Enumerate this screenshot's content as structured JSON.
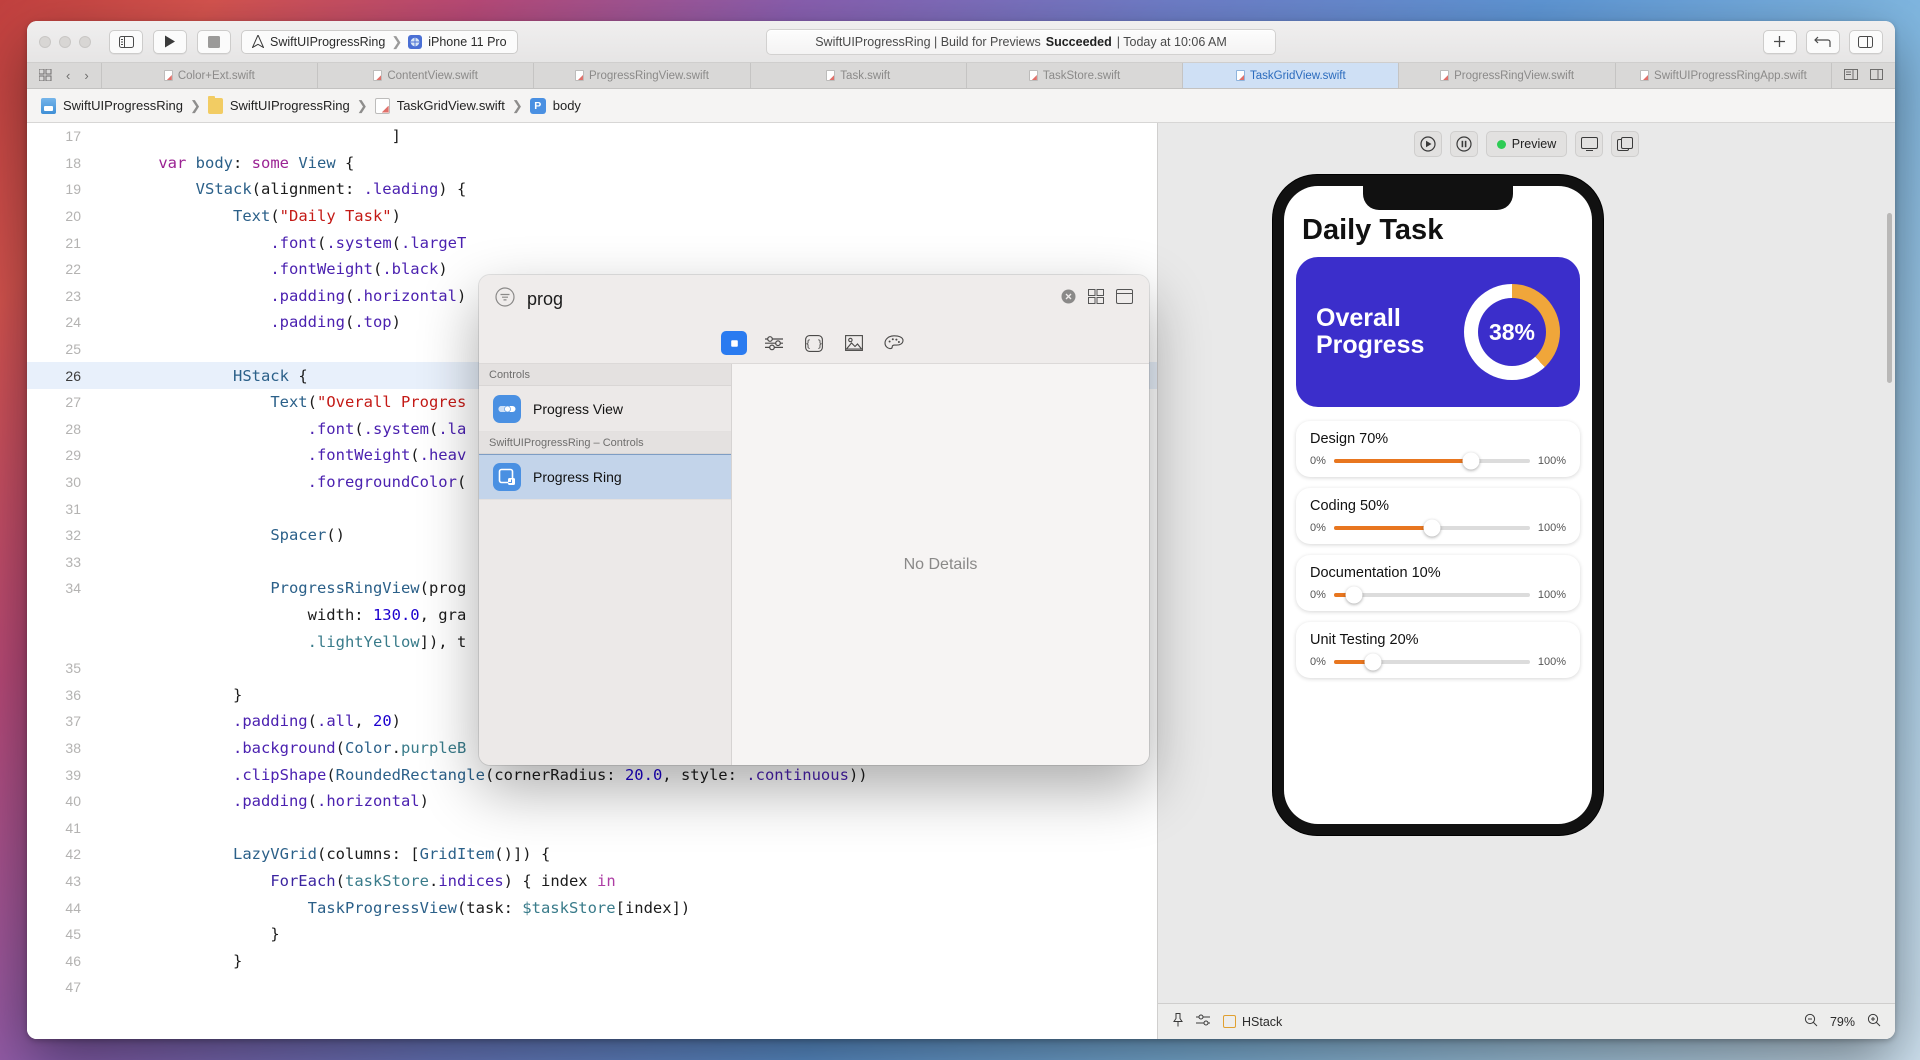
{
  "titlebar": {
    "scheme_project": "SwiftUIProgressRing",
    "scheme_device": "iPhone 11 Pro",
    "status": {
      "prefix": "SwiftUIProgressRing | Build for Previews ",
      "bold": "Succeeded",
      "suffix": " | Today at 10:06 AM"
    },
    "icons": {
      "sidebar": "sidebar-icon",
      "run": "run-play-icon",
      "stop": "stop-icon",
      "add": "plus-icon",
      "navigate": "code-review-icon",
      "inspector": "inspector-icon"
    }
  },
  "tabbar": {
    "tabs": [
      {
        "label": "Color+Ext.swift",
        "active": false
      },
      {
        "label": "ContentView.swift",
        "active": false
      },
      {
        "label": "ProgressRingView.swift",
        "active": false
      },
      {
        "label": "Task.swift",
        "active": false
      },
      {
        "label": "TaskStore.swift",
        "active": false
      },
      {
        "label": "TaskGridView.swift",
        "active": true
      },
      {
        "label": "ProgressRingView.swift",
        "active": false
      },
      {
        "label": "SwiftUIProgressRingApp.swift",
        "active": false
      }
    ]
  },
  "breadcrumb": {
    "items": [
      "SwiftUIProgressRing",
      "SwiftUIProgressRing",
      "TaskGridView.swift",
      "body"
    ],
    "symbol_badge": "P"
  },
  "editor": {
    "lines": [
      {
        "n": "17",
        "fold": false,
        "hl": false,
        "segs": [
          [
            "id",
            "                             ]"
          ]
        ]
      },
      {
        "n": "18",
        "fold": true,
        "hl": false,
        "segs": [
          [
            "id",
            "    "
          ],
          [
            "kw",
            "var"
          ],
          [
            "id",
            " "
          ],
          [
            "typ",
            "body"
          ],
          [
            "id",
            ": "
          ],
          [
            "kw",
            "some"
          ],
          [
            "id",
            " "
          ],
          [
            "typ",
            "View"
          ],
          [
            "id",
            " {"
          ]
        ]
      },
      {
        "n": "19",
        "fold": true,
        "hl": false,
        "segs": [
          [
            "id",
            "        "
          ],
          [
            "typ",
            "VStack"
          ],
          [
            "id",
            "(alignment: "
          ],
          [
            "mem",
            ".leading"
          ],
          [
            "id",
            ") {"
          ]
        ]
      },
      {
        "n": "20",
        "fold": false,
        "hl": false,
        "segs": [
          [
            "id",
            "            "
          ],
          [
            "typ",
            "Text"
          ],
          [
            "id",
            "("
          ],
          [
            "str",
            "\"Daily Task\""
          ],
          [
            "id",
            ")"
          ]
        ]
      },
      {
        "n": "21",
        "fold": false,
        "hl": false,
        "segs": [
          [
            "id",
            "                "
          ],
          [
            "mem",
            ".font"
          ],
          [
            "id",
            "("
          ],
          [
            "mem",
            ".system"
          ],
          [
            "id",
            "("
          ],
          [
            "mem",
            ".largeT"
          ]
        ]
      },
      {
        "n": "22",
        "fold": false,
        "hl": false,
        "segs": [
          [
            "id",
            "                "
          ],
          [
            "mem",
            ".fontWeight"
          ],
          [
            "id",
            "("
          ],
          [
            "mem",
            ".black"
          ],
          [
            "id",
            ")"
          ]
        ]
      },
      {
        "n": "23",
        "fold": false,
        "hl": false,
        "segs": [
          [
            "id",
            "                "
          ],
          [
            "mem",
            ".padding"
          ],
          [
            "id",
            "("
          ],
          [
            "mem",
            ".horizontal"
          ],
          [
            "id",
            ")"
          ]
        ]
      },
      {
        "n": "24",
        "fold": false,
        "hl": false,
        "segs": [
          [
            "id",
            "                "
          ],
          [
            "mem",
            ".padding"
          ],
          [
            "id",
            "("
          ],
          [
            "mem",
            ".top"
          ],
          [
            "id",
            ")"
          ]
        ]
      },
      {
        "n": "25",
        "fold": false,
        "hl": false,
        "segs": [
          [
            "id",
            ""
          ]
        ]
      },
      {
        "n": "26",
        "fold": true,
        "hl": true,
        "segs": [
          [
            "id",
            "            "
          ],
          [
            "typ",
            "HStack"
          ],
          [
            "id",
            " {"
          ]
        ]
      },
      {
        "n": "27",
        "fold": false,
        "hl": false,
        "segs": [
          [
            "id",
            "                "
          ],
          [
            "typ",
            "Text"
          ],
          [
            "id",
            "("
          ],
          [
            "str",
            "\"Overall Progres"
          ]
        ]
      },
      {
        "n": "28",
        "fold": false,
        "hl": false,
        "segs": [
          [
            "id",
            "                    "
          ],
          [
            "mem",
            ".font"
          ],
          [
            "id",
            "("
          ],
          [
            "mem",
            ".system"
          ],
          [
            "id",
            "("
          ],
          [
            "mem",
            ".la"
          ]
        ]
      },
      {
        "n": "29",
        "fold": false,
        "hl": false,
        "segs": [
          [
            "id",
            "                    "
          ],
          [
            "mem",
            ".fontWeight"
          ],
          [
            "id",
            "("
          ],
          [
            "mem",
            ".heav"
          ]
        ]
      },
      {
        "n": "30",
        "fold": false,
        "hl": false,
        "segs": [
          [
            "id",
            "                    "
          ],
          [
            "mem",
            ".foregroundColor"
          ],
          [
            "id",
            "("
          ]
        ]
      },
      {
        "n": "31",
        "fold": false,
        "hl": false,
        "segs": [
          [
            "id",
            ""
          ]
        ]
      },
      {
        "n": "32",
        "fold": false,
        "hl": false,
        "segs": [
          [
            "id",
            "                "
          ],
          [
            "typ",
            "Spacer"
          ],
          [
            "id",
            "()"
          ]
        ]
      },
      {
        "n": "33",
        "fold": false,
        "hl": false,
        "segs": [
          [
            "id",
            ""
          ]
        ]
      },
      {
        "n": "34",
        "fold": true,
        "hl": false,
        "segs": [
          [
            "id",
            "                "
          ],
          [
            "typ",
            "ProgressRingView"
          ],
          [
            "id",
            "(prog"
          ]
        ]
      },
      {
        "n": "",
        "fold": true,
        "hl": false,
        "segs": [
          [
            "id",
            "                    width: "
          ],
          [
            "num",
            "130.0"
          ],
          [
            "id",
            ", gra"
          ]
        ]
      },
      {
        "n": "",
        "fold": true,
        "hl": false,
        "segs": [
          [
            "id",
            "                    "
          ],
          [
            "tealid",
            ".lightYellow"
          ],
          [
            "id",
            "]), t"
          ]
        ]
      },
      {
        "n": "35",
        "fold": false,
        "hl": false,
        "segs": [
          [
            "id",
            ""
          ]
        ]
      },
      {
        "n": "36",
        "fold": true,
        "hl": false,
        "segs": [
          [
            "id",
            "            }"
          ]
        ]
      },
      {
        "n": "37",
        "fold": false,
        "hl": false,
        "segs": [
          [
            "id",
            "            "
          ],
          [
            "mem",
            ".padding"
          ],
          [
            "id",
            "("
          ],
          [
            "mem",
            ".all"
          ],
          [
            "id",
            ", "
          ],
          [
            "num",
            "20"
          ],
          [
            "id",
            ")"
          ]
        ]
      },
      {
        "n": "38",
        "fold": false,
        "hl": false,
        "segs": [
          [
            "id",
            "            "
          ],
          [
            "mem",
            ".background"
          ],
          [
            "id",
            "("
          ],
          [
            "typ",
            "Color"
          ],
          [
            "id",
            "."
          ],
          [
            "tealid",
            "purpleB"
          ]
        ]
      },
      {
        "n": "39",
        "fold": false,
        "hl": false,
        "segs": [
          [
            "id",
            "            "
          ],
          [
            "mem",
            ".clipShape"
          ],
          [
            "id",
            "("
          ],
          [
            "typ",
            "RoundedRectangle"
          ],
          [
            "id",
            "(cornerRadius: "
          ],
          [
            "num",
            "20.0"
          ],
          [
            "id",
            ", style: "
          ],
          [
            "mem",
            ".continuous"
          ],
          [
            "id",
            "))"
          ]
        ]
      },
      {
        "n": "40",
        "fold": false,
        "hl": false,
        "segs": [
          [
            "id",
            "            "
          ],
          [
            "mem",
            ".padding"
          ],
          [
            "id",
            "("
          ],
          [
            "mem",
            ".horizontal"
          ],
          [
            "id",
            ")"
          ]
        ]
      },
      {
        "n": "41",
        "fold": false,
        "hl": false,
        "segs": [
          [
            "id",
            ""
          ]
        ]
      },
      {
        "n": "42",
        "fold": true,
        "hl": false,
        "segs": [
          [
            "id",
            "            "
          ],
          [
            "typ",
            "LazyVGrid"
          ],
          [
            "id",
            "(columns: ["
          ],
          [
            "typ",
            "GridItem"
          ],
          [
            "id",
            "()]) {"
          ]
        ]
      },
      {
        "n": "43",
        "fold": true,
        "hl": false,
        "segs": [
          [
            "id",
            "                "
          ],
          [
            "fn",
            "ForEach"
          ],
          [
            "id",
            "("
          ],
          [
            "tealid",
            "taskStore"
          ],
          [
            "id",
            "."
          ],
          [
            "mem",
            "indices"
          ],
          [
            "id",
            ") { index "
          ],
          [
            "pinkkw",
            "in"
          ]
        ]
      },
      {
        "n": "44",
        "fold": true,
        "hl": false,
        "segs": [
          [
            "id",
            "                    "
          ],
          [
            "typ",
            "TaskProgressView"
          ],
          [
            "id",
            "(task: "
          ],
          [
            "tealid",
            "$taskStore"
          ],
          [
            "id",
            "[index])"
          ]
        ]
      },
      {
        "n": "45",
        "fold": true,
        "hl": false,
        "segs": [
          [
            "id",
            "                "
          ],
          [
            "id",
            "}"
          ]
        ]
      },
      {
        "n": "46",
        "fold": true,
        "hl": false,
        "segs": [
          [
            "id",
            "            }"
          ]
        ]
      },
      {
        "n": "47",
        "fold": false,
        "hl": false,
        "segs": [
          [
            "id",
            ""
          ]
        ]
      }
    ]
  },
  "library": {
    "search_value": "prog",
    "search_icon": "filter-icon",
    "clear_icon": "clear-circle-icon",
    "grid_icon": "grid-layout-icon",
    "detail_icon": "detail-panel-icon",
    "segments": [
      {
        "name": "views-segment",
        "icon": "square-views-icon",
        "active": true
      },
      {
        "name": "modifiers-segment",
        "icon": "sliders-icon",
        "active": false
      },
      {
        "name": "snippets-segment",
        "icon": "braces-icon",
        "active": false
      },
      {
        "name": "media-segment",
        "icon": "image-icon",
        "active": false
      },
      {
        "name": "color-segment",
        "icon": "palette-icon",
        "active": false
      }
    ],
    "groups": [
      {
        "header": "Controls",
        "items": [
          {
            "label": "Progress View",
            "icon": "progress-view-icon",
            "selected": false
          }
        ]
      },
      {
        "header": "SwiftUIProgressRing – Controls",
        "items": [
          {
            "label": "Progress Ring",
            "icon": "progress-ring-icon",
            "selected": true
          }
        ]
      }
    ],
    "detail_empty": "No Details"
  },
  "preview": {
    "toolbar": {
      "live_label": "Preview",
      "play_icon": "play-circle-icon",
      "pause_icon": "pause-circle-icon",
      "device_icon": "display-icon",
      "duplicate_icon": "duplicate-icon"
    },
    "device": {
      "title": "Daily Task",
      "overall": {
        "label_line1": "Overall",
        "label_line2": "Progress",
        "percent": "38%",
        "percent_value": 38,
        "card_color": "#3b2ecb",
        "ring_color": "#f0a63a"
      },
      "tasks": [
        {
          "name": "Design",
          "percent": "70%",
          "value": 70,
          "min": "0%",
          "max": "100%"
        },
        {
          "name": "Coding",
          "percent": "50%",
          "value": 50,
          "min": "0%",
          "max": "100%"
        },
        {
          "name": "Documentation",
          "percent": "10%",
          "value": 10,
          "min": "0%",
          "max": "100%"
        },
        {
          "name": "Unit Testing",
          "percent": "20%",
          "value": 20,
          "min": "0%",
          "max": "100%"
        }
      ]
    },
    "bottombar": {
      "pin_icon": "pin-icon",
      "settings_icon": "sliders-icon",
      "selection": "HStack",
      "zoom_out_icon": "zoom-out-icon",
      "zoom_level": "79%",
      "zoom_in_icon": "zoom-in-icon"
    }
  }
}
